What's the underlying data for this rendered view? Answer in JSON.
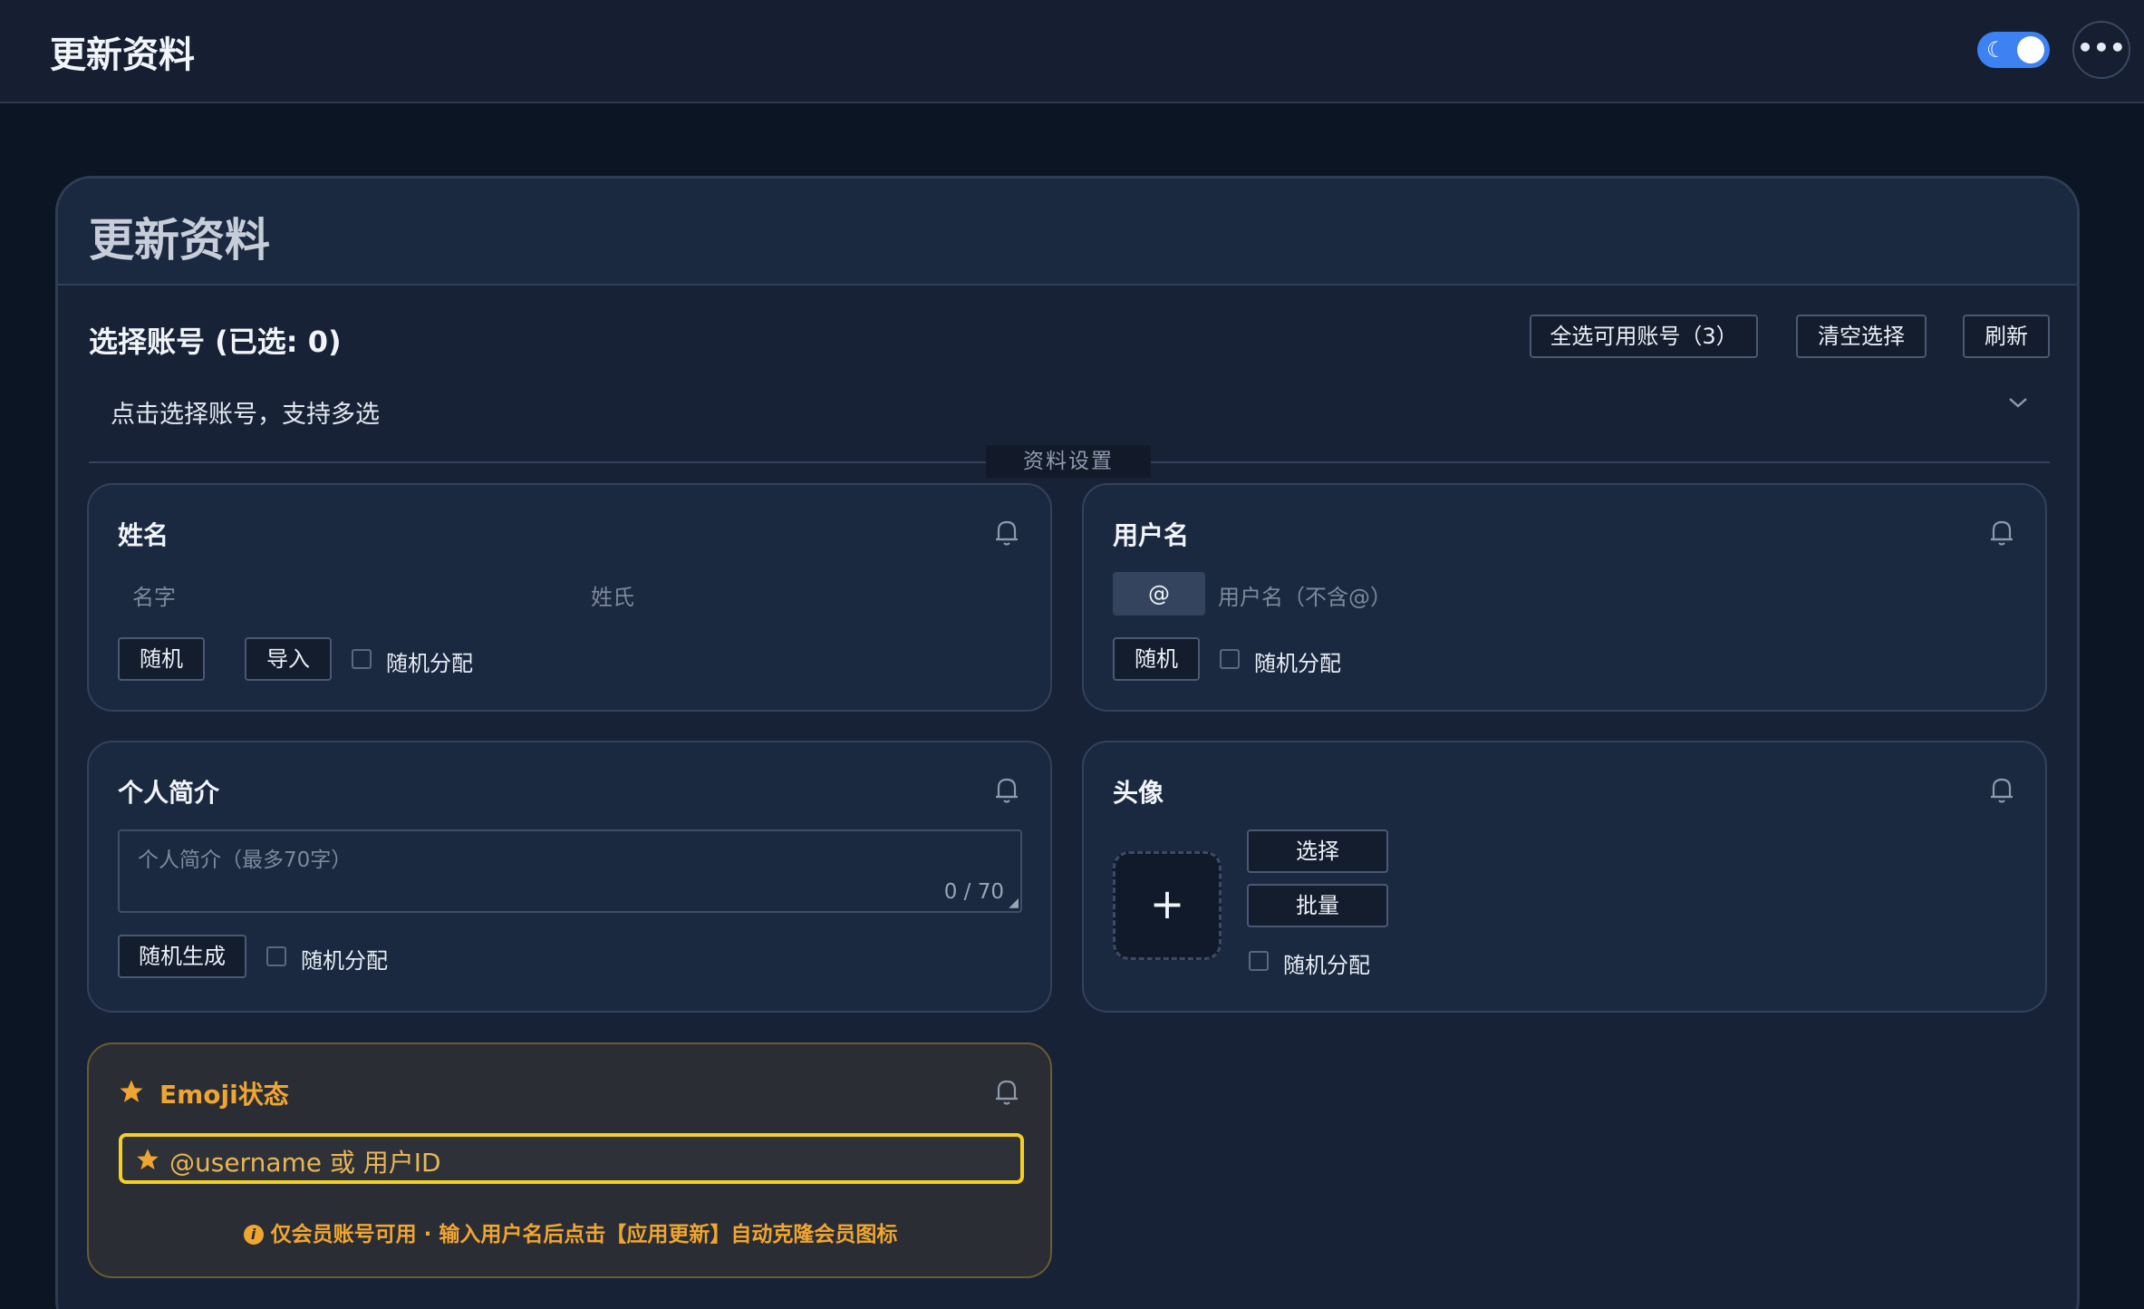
{
  "topbar": {
    "title": "更新资料",
    "theme_icon": "moon-icon",
    "more_label": "•••"
  },
  "card": {
    "title": "更新资料"
  },
  "accounts": {
    "section_title": "选择账号 (已选: 0)",
    "select_all_label": "全选可用账号（3）",
    "clear_label": "清空选择",
    "refresh_label": "刷新",
    "select_placeholder": "点击选择账号，支持多选",
    "chevron": "⌄"
  },
  "divider_label": "资料设置",
  "name_panel": {
    "title": "姓名",
    "first_name_placeholder": "名字",
    "last_name_placeholder": "姓氏",
    "random_label": "随机",
    "import_label": "导入",
    "random_assign_label": "随机分配"
  },
  "username_panel": {
    "title": "用户名",
    "prefix": "@",
    "username_placeholder": "用户名（不含@）",
    "random_label": "随机",
    "random_assign_label": "随机分配"
  },
  "bio_panel": {
    "title": "个人简介",
    "placeholder": "个人简介（最多70字）",
    "counter": "0 / 70",
    "generate_label": "随机生成",
    "random_assign_label": "随机分配"
  },
  "avatar_panel": {
    "title": "头像",
    "add_symbol": "+",
    "select_label": "选择",
    "batch_label": "批量",
    "random_assign_label": "随机分配"
  },
  "emoji_panel": {
    "title": "Emoji状态",
    "input_placeholder": "@username 或 用户ID",
    "info_symbol": "i",
    "note": "仅会员账号可用 · 输入用户名后点击【应用更新】自动克隆会员图标"
  },
  "colors": {
    "accent_blue": "#3d82f2",
    "emoji_gold": "#f0a531",
    "input_highlight": "#f5d020"
  }
}
